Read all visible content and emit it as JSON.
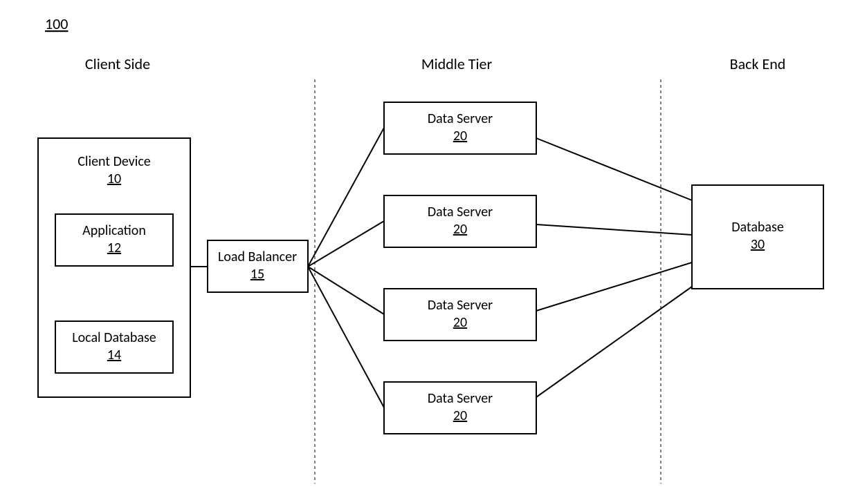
{
  "figure_number": "100",
  "tiers": {
    "client": "Client Side",
    "middle": "Middle Tier",
    "back": "Back End"
  },
  "blocks": {
    "client_device": {
      "label": "Client Device",
      "ref": "10"
    },
    "application": {
      "label": "Application",
      "ref": "12"
    },
    "local_db": {
      "label": "Local Database",
      "ref": "14"
    },
    "load_balancer": {
      "label": "Load Balancer",
      "ref": "15"
    },
    "data_server_1": {
      "label": "Data Server",
      "ref": "20"
    },
    "data_server_2": {
      "label": "Data Server",
      "ref": "20"
    },
    "data_server_3": {
      "label": "Data Server",
      "ref": "20"
    },
    "data_server_4": {
      "label": "Data Server",
      "ref": "20"
    },
    "database": {
      "label": "Database",
      "ref": "30"
    }
  }
}
